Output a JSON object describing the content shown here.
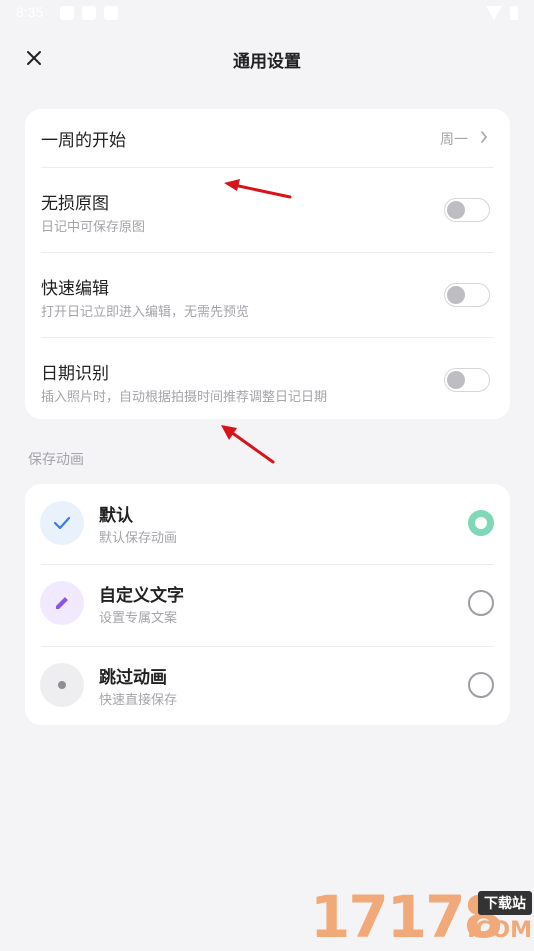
{
  "status_bar": {
    "time": "8:35"
  },
  "header": {
    "title": "通用设置",
    "close_icon": "close-icon"
  },
  "settings": {
    "week_start": {
      "label": "一周的开始",
      "value": "周一"
    },
    "lossless": {
      "label": "无损原图",
      "subtitle": "日记中可保存原图",
      "enabled": false
    },
    "quick_edit": {
      "label": "快速编辑",
      "subtitle": "打开日记立即进入编辑，无需先预览",
      "enabled": false
    },
    "date_detect": {
      "label": "日期识别",
      "subtitle": "插入照片时，自动根据拍摄时间推荐调整日记日期",
      "enabled": false
    }
  },
  "save_animation": {
    "section_label": "保存动画",
    "options": [
      {
        "title": "默认",
        "subtitle": "默认保存动画",
        "icon": "check-icon",
        "selected": true
      },
      {
        "title": "自定义文字",
        "subtitle": "设置专属文案",
        "icon": "pencil-icon",
        "selected": false
      },
      {
        "title": "跳过动画",
        "subtitle": "快速直接保存",
        "icon": "dot-icon",
        "selected": false
      }
    ]
  },
  "watermark": {
    "digits": "17178",
    "badge": "下载站",
    "suffix": ".COM"
  },
  "colors": {
    "accent_green": "#7fd8b8",
    "check_blue": "#3d7be6",
    "pencil_purple": "#8a56e6",
    "arrow_red": "#d8141b"
  }
}
